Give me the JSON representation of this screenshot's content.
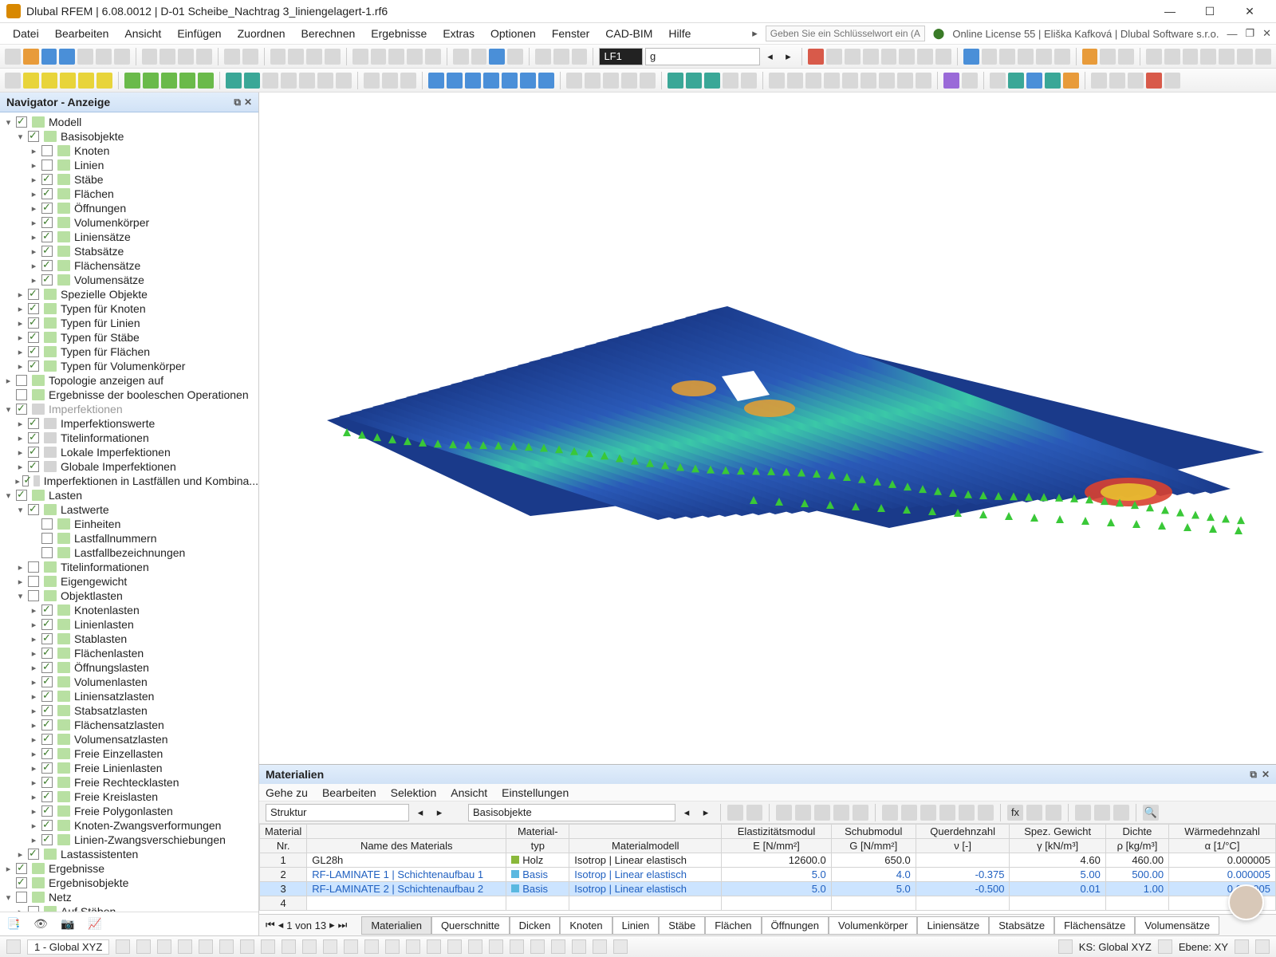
{
  "title": "Dlubal RFEM | 6.08.0012 | D-01 Scheibe_Nachtrag 3_liniengelagert-1.rf6",
  "searchPlaceholder": "Geben Sie ein Schlüsselwort ein (Alt...",
  "license": "Online License 55 | Eliška Kafková | Dlubal Software s.r.o.",
  "menu": [
    "Datei",
    "Bearbeiten",
    "Ansicht",
    "Einfügen",
    "Zuordnen",
    "Berechnen",
    "Ergebnisse",
    "Extras",
    "Optionen",
    "Fenster",
    "CAD-BIM",
    "Hilfe"
  ],
  "loadcase": "LF1",
  "loadcaseLetter": "g",
  "navigator": {
    "title": "Navigator - Anzeige",
    "items": [
      {
        "ind": 0,
        "exp": "▾",
        "chk": true,
        "ic": "b",
        "label": "Modell"
      },
      {
        "ind": 1,
        "exp": "▾",
        "chk": true,
        "ic": "b",
        "label": "Basisobjekte"
      },
      {
        "ind": 2,
        "exp": "▸",
        "chk": false,
        "ic": "b",
        "label": "Knoten"
      },
      {
        "ind": 2,
        "exp": "▸",
        "chk": false,
        "ic": "b",
        "label": "Linien"
      },
      {
        "ind": 2,
        "exp": "▸",
        "chk": true,
        "ic": "b",
        "label": "Stäbe"
      },
      {
        "ind": 2,
        "exp": "▸",
        "chk": true,
        "ic": "b",
        "label": "Flächen"
      },
      {
        "ind": 2,
        "exp": "▸",
        "chk": true,
        "ic": "b",
        "label": "Öffnungen"
      },
      {
        "ind": 2,
        "exp": "▸",
        "chk": true,
        "ic": "b",
        "label": "Volumenkörper"
      },
      {
        "ind": 2,
        "exp": "▸",
        "chk": true,
        "ic": "b",
        "label": "Liniensätze"
      },
      {
        "ind": 2,
        "exp": "▸",
        "chk": true,
        "ic": "b",
        "label": "Stabsätze"
      },
      {
        "ind": 2,
        "exp": "▸",
        "chk": true,
        "ic": "b",
        "label": "Flächensätze"
      },
      {
        "ind": 2,
        "exp": "▸",
        "chk": true,
        "ic": "b",
        "label": "Volumensätze"
      },
      {
        "ind": 1,
        "exp": "▸",
        "chk": true,
        "ic": "b",
        "label": "Spezielle Objekte"
      },
      {
        "ind": 1,
        "exp": "▸",
        "chk": true,
        "ic": "b",
        "label": "Typen für Knoten"
      },
      {
        "ind": 1,
        "exp": "▸",
        "chk": true,
        "ic": "b",
        "label": "Typen für Linien"
      },
      {
        "ind": 1,
        "exp": "▸",
        "chk": true,
        "ic": "b",
        "label": "Typen für Stäbe"
      },
      {
        "ind": 1,
        "exp": "▸",
        "chk": true,
        "ic": "b",
        "label": "Typen für Flächen"
      },
      {
        "ind": 1,
        "exp": "▸",
        "chk": true,
        "ic": "b",
        "label": "Typen für Volumenkörper"
      },
      {
        "ind": 0,
        "exp": "▸",
        "chk": false,
        "ic": "b",
        "label": "Topologie anzeigen auf"
      },
      {
        "ind": 0,
        "exp": "",
        "chk": false,
        "ic": "b",
        "label": "Ergebnisse der booleschen Operationen"
      },
      {
        "ind": 0,
        "exp": "▾",
        "chk": true,
        "ic": "g",
        "label": "Imperfektionen",
        "dim": true
      },
      {
        "ind": 1,
        "exp": "▸",
        "chk": true,
        "ic": "g",
        "label": "Imperfektionswerte"
      },
      {
        "ind": 1,
        "exp": "▸",
        "chk": true,
        "ic": "g",
        "label": "Titelinformationen"
      },
      {
        "ind": 1,
        "exp": "▸",
        "chk": true,
        "ic": "g",
        "label": "Lokale Imperfektionen"
      },
      {
        "ind": 1,
        "exp": "▸",
        "chk": true,
        "ic": "g",
        "label": "Globale Imperfektionen"
      },
      {
        "ind": 1,
        "exp": "▸",
        "chk": true,
        "ic": "g",
        "label": "Imperfektionen in Lastfällen und Kombina..."
      },
      {
        "ind": 0,
        "exp": "▾",
        "chk": true,
        "ic": "b",
        "label": "Lasten"
      },
      {
        "ind": 1,
        "exp": "▾",
        "chk": true,
        "ic": "b",
        "label": "Lastwerte"
      },
      {
        "ind": 2,
        "exp": "",
        "chk": false,
        "ic": "b",
        "label": "Einheiten"
      },
      {
        "ind": 2,
        "exp": "",
        "chk": false,
        "ic": "b",
        "label": "Lastfallnummern"
      },
      {
        "ind": 2,
        "exp": "",
        "chk": false,
        "ic": "b",
        "label": "Lastfallbezeichnungen"
      },
      {
        "ind": 1,
        "exp": "▸",
        "chk": false,
        "ic": "b",
        "label": "Titelinformationen"
      },
      {
        "ind": 1,
        "exp": "▸",
        "chk": false,
        "ic": "b",
        "label": "Eigengewicht"
      },
      {
        "ind": 1,
        "exp": "▾",
        "chk": false,
        "ic": "b",
        "label": "Objektlasten"
      },
      {
        "ind": 2,
        "exp": "▸",
        "chk": true,
        "ic": "b",
        "label": "Knotenlasten"
      },
      {
        "ind": 2,
        "exp": "▸",
        "chk": true,
        "ic": "b",
        "label": "Linienlasten"
      },
      {
        "ind": 2,
        "exp": "▸",
        "chk": true,
        "ic": "b",
        "label": "Stablasten"
      },
      {
        "ind": 2,
        "exp": "▸",
        "chk": true,
        "ic": "b",
        "label": "Flächenlasten"
      },
      {
        "ind": 2,
        "exp": "▸",
        "chk": true,
        "ic": "b",
        "label": "Öffnungslasten"
      },
      {
        "ind": 2,
        "exp": "▸",
        "chk": true,
        "ic": "b",
        "label": "Volumenlasten"
      },
      {
        "ind": 2,
        "exp": "▸",
        "chk": true,
        "ic": "b",
        "label": "Liniensatzlasten"
      },
      {
        "ind": 2,
        "exp": "▸",
        "chk": true,
        "ic": "b",
        "label": "Stabsatzlasten"
      },
      {
        "ind": 2,
        "exp": "▸",
        "chk": true,
        "ic": "b",
        "label": "Flächensatzlasten"
      },
      {
        "ind": 2,
        "exp": "▸",
        "chk": true,
        "ic": "b",
        "label": "Volumensatzlasten"
      },
      {
        "ind": 2,
        "exp": "▸",
        "chk": true,
        "ic": "b",
        "label": "Freie Einzellasten"
      },
      {
        "ind": 2,
        "exp": "▸",
        "chk": true,
        "ic": "b",
        "label": "Freie Linienlasten"
      },
      {
        "ind": 2,
        "exp": "▸",
        "chk": true,
        "ic": "b",
        "label": "Freie Rechtecklasten"
      },
      {
        "ind": 2,
        "exp": "▸",
        "chk": true,
        "ic": "b",
        "label": "Freie Kreislasten"
      },
      {
        "ind": 2,
        "exp": "▸",
        "chk": true,
        "ic": "b",
        "label": "Freie Polygonlasten"
      },
      {
        "ind": 2,
        "exp": "▸",
        "chk": true,
        "ic": "b",
        "label": "Knoten-Zwangsverformungen"
      },
      {
        "ind": 2,
        "exp": "▸",
        "chk": true,
        "ic": "b",
        "label": "Linien-Zwangsverschiebungen"
      },
      {
        "ind": 1,
        "exp": "▸",
        "chk": true,
        "ic": "b",
        "label": "Lastassistenten"
      },
      {
        "ind": 0,
        "exp": "▸",
        "chk": true,
        "ic": "b",
        "label": "Ergebnisse"
      },
      {
        "ind": 0,
        "exp": "",
        "chk": true,
        "ic": "b",
        "label": "Ergebnisobjekte"
      },
      {
        "ind": 0,
        "exp": "▾",
        "chk": false,
        "ic": "b",
        "label": "Netz"
      },
      {
        "ind": 1,
        "exp": "▸",
        "chk": false,
        "ic": "b",
        "label": "Auf Stäben"
      }
    ]
  },
  "materials": {
    "title": "Materialien",
    "menu": [
      "Gehe zu",
      "Bearbeiten",
      "Selektion",
      "Ansicht",
      "Einstellungen"
    ],
    "combo1": "Struktur",
    "combo2": "Basisobjekte",
    "headers1": [
      "Material",
      "",
      "Material-",
      "",
      "Elastizitätsmodul",
      "Schubmodul",
      "Querdehnzahl",
      "Spez. Gewicht",
      "Dichte",
      "Wärmedehnzahl"
    ],
    "headers2": [
      "Nr.",
      "Name des Materials",
      "typ",
      "Materialmodell",
      "E [N/mm²]",
      "G [N/mm²]",
      "ν [-]",
      "γ [kN/m³]",
      "ρ [kg/m³]",
      "α [1/°C]"
    ],
    "rows": [
      {
        "nr": "1",
        "name": "GL28h",
        "typ": "Holz",
        "modell": "Isotrop | Linear elastisch",
        "e": "12600.0",
        "g": "650.0",
        "v": "",
        "gamma": "4.60",
        "rho": "460.00",
        "alpha": "0.000005"
      },
      {
        "nr": "2",
        "name": "RF-LAMINATE 1 | Schichtenaufbau 1",
        "typ": "Basis",
        "modell": "Isotrop | Linear elastisch",
        "e": "5.0",
        "g": "4.0",
        "v": "-0.375",
        "gamma": "5.00",
        "rho": "500.00",
        "alpha": "0.000005"
      },
      {
        "nr": "3",
        "name": "RF-LAMINATE 2 | Schichtenaufbau 2",
        "typ": "Basis",
        "modell": "Isotrop | Linear elastisch",
        "e": "5.0",
        "g": "5.0",
        "v": "-0.500",
        "gamma": "0.01",
        "rho": "1.00",
        "alpha": "0.000005",
        "sel": true
      },
      {
        "nr": "4",
        "name": "",
        "typ": "",
        "modell": "",
        "e": "",
        "g": "",
        "v": "",
        "gamma": "",
        "rho": "",
        "alpha": ""
      }
    ],
    "pager": "1 von 13",
    "tabs": [
      "Materialien",
      "Querschnitte",
      "Dicken",
      "Knoten",
      "Linien",
      "Stäbe",
      "Flächen",
      "Öffnungen",
      "Volumenkörper",
      "Liniensätze",
      "Stabsätze",
      "Flächensätze",
      "Volumensätze"
    ]
  },
  "status": {
    "coords": "1 - Global XYZ",
    "ks": "KS: Global XYZ",
    "ebene": "Ebene: XY"
  }
}
